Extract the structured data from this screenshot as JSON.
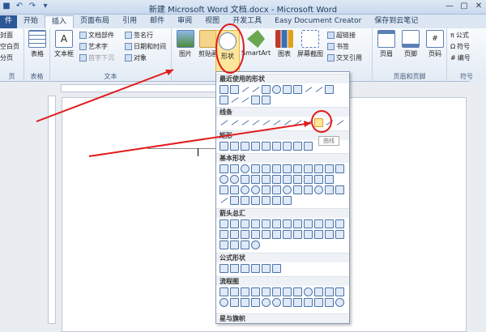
{
  "window": {
    "title": "新建 Microsoft Word 文档.docx - Microsoft Word",
    "controls": [
      "—",
      "▢",
      "✕"
    ]
  },
  "tabs": [
    {
      "label": "件",
      "name": "tab-file"
    },
    {
      "label": "开始",
      "name": "tab-home"
    },
    {
      "label": "插入",
      "name": "tab-insert"
    },
    {
      "label": "页面布局",
      "name": "tab-page-layout"
    },
    {
      "label": "引用",
      "name": "tab-references"
    },
    {
      "label": "邮件",
      "name": "tab-mailings"
    },
    {
      "label": "审阅",
      "name": "tab-review"
    },
    {
      "label": "视图",
      "name": "tab-view"
    },
    {
      "label": "开发工具",
      "name": "tab-developer"
    },
    {
      "label": "Easy Document Creator",
      "name": "tab-easy-document-creator"
    },
    {
      "label": "保存到云笔记",
      "name": "tab-save-cloud-note"
    }
  ],
  "ribbon": {
    "pages_group": {
      "items": [
        "封面",
        "空白页",
        "分页"
      ],
      "label": "页"
    },
    "table": {
      "label": "表格",
      "group": "表格"
    },
    "text_group": {
      "textbox": "文本框",
      "quickparts": "文档部件",
      "wordart": "艺术字",
      "dropcap": "首字下沉",
      "signature": "签名行",
      "datetime": "日期和时间",
      "object": "对象",
      "label": "文本"
    },
    "illustrations": {
      "picture": "图片",
      "clipart": "剪贴画",
      "shapes": "形状",
      "smartart": "SmartArt",
      "chart": "图表",
      "screenshot": "屏幕截图"
    },
    "links": {
      "hyperlink": "超链接",
      "bookmark": "书签",
      "crossref": "交叉引用"
    },
    "header_footer": {
      "header": "页眉",
      "footer": "页脚",
      "pagenum": "页码",
      "label": "页眉和页脚"
    },
    "symbols": {
      "equation": "公式",
      "symbol": "符号",
      "number": "编号",
      "label": "符号"
    }
  },
  "shapes_menu": {
    "recent": "最近使用的形状",
    "lines": "线条",
    "rectangles": "矩形",
    "basic": "基本形状",
    "arrows": "箭头总汇",
    "equation": "公式形状",
    "flowchart": "流程图",
    "stars": "星与旗帜",
    "tooltip": "曲线"
  }
}
